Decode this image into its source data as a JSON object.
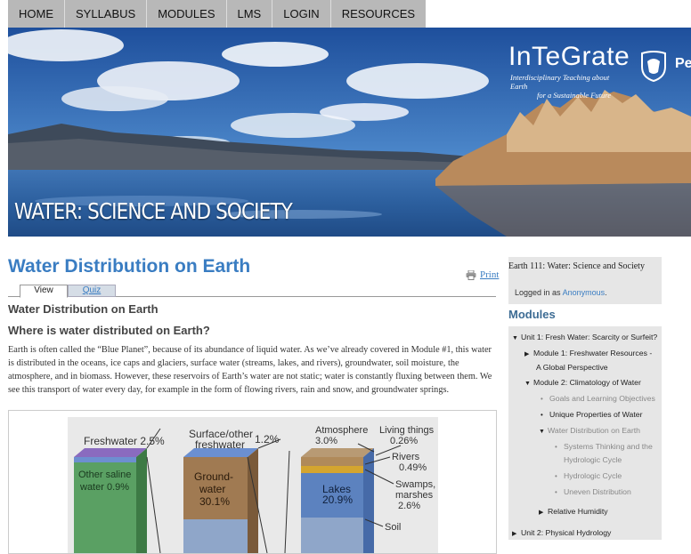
{
  "nav": {
    "items": [
      "HOME",
      "SYLLABUS",
      "MODULES",
      "LMS",
      "LOGIN",
      "RESOURCES"
    ]
  },
  "banner": {
    "course_title": "WATER: SCIENCE AND SOCIETY",
    "brand": "InTeGrate",
    "tagline_line1": "Interdisciplinary Teaching about Earth",
    "tagline_line2": "for a Sustainable Future",
    "psu_text": "Pe"
  },
  "main": {
    "title": "Water Distribution on Earth",
    "print_label": "Print",
    "tabs": {
      "view": "View",
      "quiz": "Quiz"
    },
    "subheading": "Water Distribution on Earth",
    "question": "Where is water distributed on Earth?",
    "paragraph": "Earth is often called the “Blue Planet”, because of its abundance of liquid water. As we’ve already covered in Module #1, this water is distributed in the oceans, ice caps and glaciers, surface water (streams, lakes, and rivers), groundwater, soil moisture, the atmosphere, and in biomass. However, these reservoirs of Earth’s water are not static; water is constantly fluxing between them. We see this transport of water every day, for example in the form of flowing rivers, rain and snow, and groundwater springs."
  },
  "figure": {
    "freshwater": "Freshwater 2.5%",
    "other_saline_line1": "Other saline",
    "other_saline_line2": "water 0.9%",
    "surface_line1": "Surface/other",
    "surface_line2": "freshwater",
    "surface_pct": "1.2%",
    "ground_line1": "Ground-",
    "ground_line2": "water",
    "ground_pct": "30.1%",
    "atmosphere": "Atmosphere",
    "atmosphere_pct": "3.0%",
    "living_things": "Living things",
    "living_pct": "0.26%",
    "rivers": "Rivers",
    "rivers_pct": "0.49%",
    "lakes": "Lakes",
    "lakes_pct": "20.9%",
    "swamps_line1": "Swamps,",
    "swamps_line2": "marshes",
    "swamps_pct": "2.6%",
    "soil": "Soil"
  },
  "sidebar": {
    "course": "Earth 111: Water: Science and Society",
    "logged_in_prefix": "Logged in as ",
    "user": "Anonymous",
    "user_suffix": ".",
    "modules_heading": "Modules",
    "items": {
      "unit1": "Unit 1: Fresh Water: Scarcity or Surfeit?",
      "module1_line1": "Module 1: Freshwater Resources -",
      "module1_line2": "A Global Perspective",
      "module2": "Module 2: Climatology of Water",
      "goals": "Goals and Learning Objectives",
      "unique": "Unique Properties of Water",
      "distribution": "Water Distribution on Earth",
      "systems_line1": "Systems Thinking and the",
      "systems_line2": "Hydrologic Cycle",
      "hydro": "Hydrologic Cycle",
      "uneven": "Uneven Distribution",
      "humidity": "Relative Humidity",
      "unit2": "Unit 2: Physical Hydrology"
    }
  },
  "colors": {
    "link_blue": "#3a7dc2",
    "nav_grey": "#b8b8b8",
    "sidebar_grey": "#e6e6e6"
  }
}
